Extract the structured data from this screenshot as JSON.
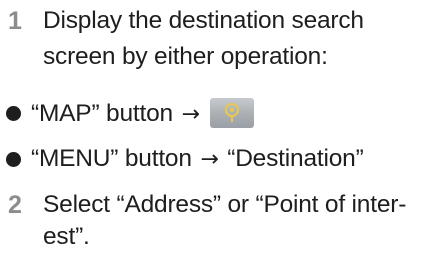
{
  "step1": {
    "number": "1",
    "line1": "Display the destination search",
    "line2": "screen by either operation:"
  },
  "bullets": [
    {
      "before_arrow": "“MAP” button",
      "arrow": "→",
      "icon": "destination-pin-icon"
    },
    {
      "before_arrow": "“MENU” button",
      "arrow": "→",
      "after_arrow": "“Destination”"
    }
  ],
  "step2": {
    "number": "2",
    "line1": "Select “Address” or “Point of inter-",
    "line2": "est”."
  },
  "colors": {
    "text": "#1e1e1e",
    "step_number": "#8c8c8c",
    "icon_button": "#a9aeb3",
    "icon_glyph": "#e8c94a"
  }
}
